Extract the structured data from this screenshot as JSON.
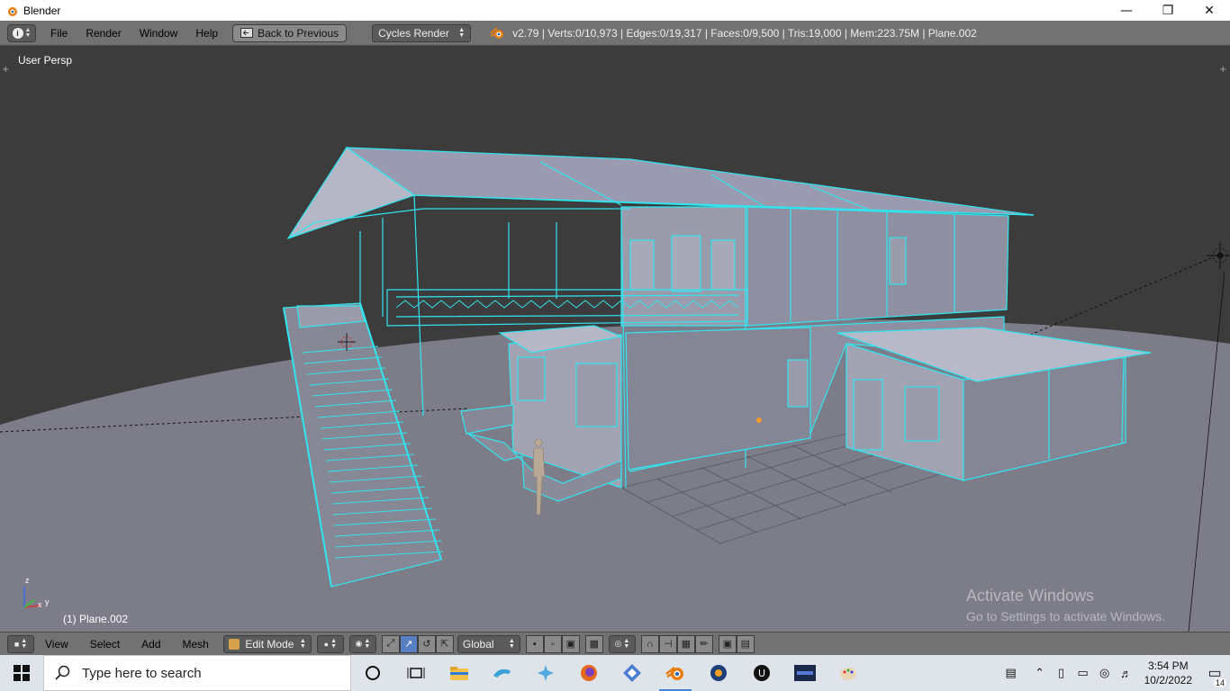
{
  "window": {
    "title": "Blender"
  },
  "infobar": {
    "menus": [
      "File",
      "Render",
      "Window",
      "Help"
    ],
    "back_label": "Back to Previous",
    "engine": "Cycles Render",
    "stats": "v2.79 | Verts:0/10,973 | Edges:0/19,317 | Faces:0/9,500 | Tris:19,000 | Mem:223.75M | Plane.002"
  },
  "viewport": {
    "view_label": "User Persp",
    "object_label": "(1) Plane.002",
    "axis": {
      "z": "z",
      "x": "x",
      "y": "y"
    },
    "wire_color": "#2fe6f0",
    "mesh_color": "#8e8fa0",
    "bg_color": "#3c3c3c",
    "ground_color": "#7d7d8a"
  },
  "watermark": {
    "line1": "Activate Windows",
    "line2": "Go to Settings to activate Windows."
  },
  "toolbar": {
    "menus": [
      "View",
      "Select",
      "Add",
      "Mesh"
    ],
    "mode": "Edit Mode",
    "orientation": "Global"
  },
  "taskbar": {
    "search_placeholder": "Type here to search",
    "time": "3:54 PM",
    "date": "10/2/2022",
    "notifications": "14"
  }
}
